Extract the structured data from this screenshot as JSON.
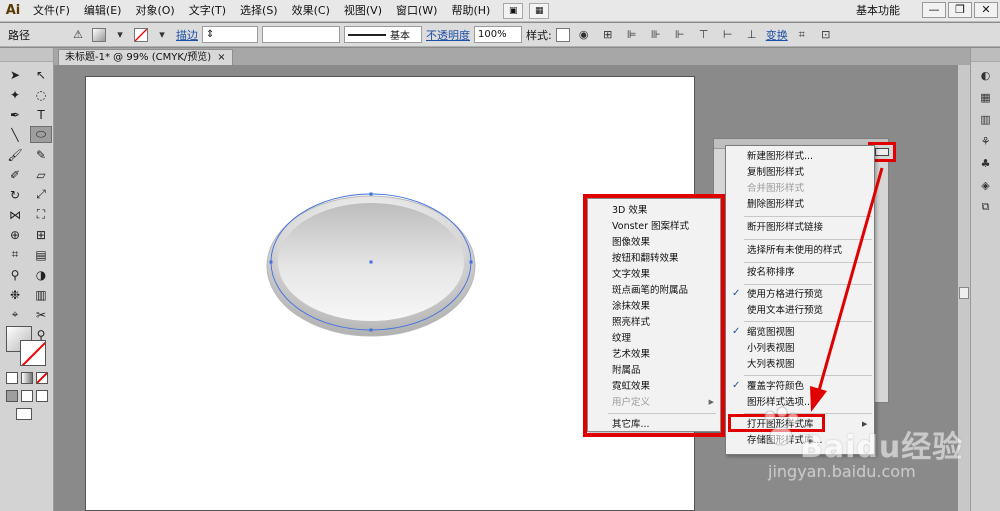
{
  "app": {
    "logo": "Ai"
  },
  "menubar": {
    "items": [
      "文件(F)",
      "编辑(E)",
      "对象(O)",
      "文字(T)",
      "选择(S)",
      "效果(C)",
      "视图(V)",
      "窗口(W)",
      "帮助(H)"
    ],
    "workspace": "基本功能",
    "window_controls": [
      "—",
      "❐",
      "✕"
    ]
  },
  "controlbar": {
    "object_type": "路径",
    "stroke_link": "描边",
    "stroke_profile": "基本",
    "opacity_link": "不透明度",
    "opacity_value": "100%",
    "style_label": "样式:",
    "transform_link": "变换"
  },
  "document": {
    "tab_title": "未标题-1* @ 99% (CMYK/预览)",
    "close": "×"
  },
  "graphic_styles_menu": {
    "items": [
      {
        "label": "新建图形样式...",
        "disabled": false,
        "checked": false
      },
      {
        "label": "复制图形样式",
        "disabled": false,
        "checked": false
      },
      {
        "label": "合并图形样式",
        "disabled": true,
        "checked": false
      },
      {
        "label": "删除图形样式",
        "disabled": false,
        "checked": false
      },
      {
        "label": "断开图形样式链接",
        "disabled": false,
        "checked": false
      },
      {
        "label": "选择所有未使用的样式",
        "disabled": false,
        "checked": false
      },
      {
        "label": "按名称排序",
        "disabled": false,
        "checked": false
      },
      {
        "label": "使用方格进行预览",
        "disabled": false,
        "checked": true
      },
      {
        "label": "使用文本进行预览",
        "disabled": false,
        "checked": false
      },
      {
        "label": "缩览图视图",
        "disabled": false,
        "checked": true
      },
      {
        "label": "小列表视图",
        "disabled": false,
        "checked": false
      },
      {
        "label": "大列表视图",
        "disabled": false,
        "checked": false
      },
      {
        "label": "覆盖字符颜色",
        "disabled": false,
        "checked": true
      },
      {
        "label": "图形样式选项...",
        "disabled": false,
        "checked": false
      },
      {
        "label": "打开图形样式库",
        "disabled": false,
        "checked": false
      },
      {
        "label": "存储图形样式库...",
        "disabled": false,
        "checked": false
      }
    ]
  },
  "style_library_submenu": {
    "items": [
      {
        "label": "3D 效果",
        "disabled": false
      },
      {
        "label": "Vonster 图案样式",
        "disabled": false
      },
      {
        "label": "图像效果",
        "disabled": false
      },
      {
        "label": "按钮和翻转效果",
        "disabled": false
      },
      {
        "label": "文字效果",
        "disabled": false
      },
      {
        "label": "斑点画笔的附属品",
        "disabled": false
      },
      {
        "label": "涂抹效果",
        "disabled": false
      },
      {
        "label": "照亮样式",
        "disabled": false
      },
      {
        "label": "纹理",
        "disabled": false
      },
      {
        "label": "艺术效果",
        "disabled": false
      },
      {
        "label": "附属品",
        "disabled": false
      },
      {
        "label": "霓虹效果",
        "disabled": false
      },
      {
        "label": "用户定义",
        "disabled": true
      },
      {
        "label": "其它库...",
        "disabled": false
      }
    ]
  },
  "watermark": {
    "brand": "Baidu经验",
    "url": "jingyan.baidu.com"
  },
  "colors": {
    "highlight": "#e00000",
    "accent": "#1d4fa6",
    "anchor": "#3f6fe0"
  }
}
